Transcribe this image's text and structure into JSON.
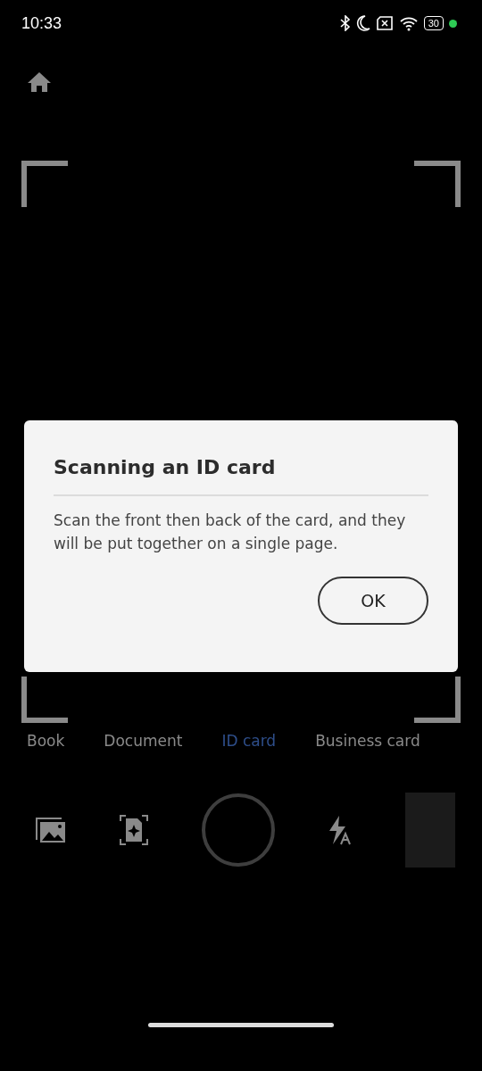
{
  "status_bar": {
    "time": "10:33",
    "battery": "30"
  },
  "dialog": {
    "title": "Scanning an ID card",
    "message": "Scan the front then back of the card, and they will be put together on a single page.",
    "button": "OK"
  },
  "modes": [
    {
      "label": "Book",
      "selected": false
    },
    {
      "label": "Document",
      "selected": false
    },
    {
      "label": "ID card",
      "selected": true
    },
    {
      "label": "Business card",
      "selected": false
    }
  ]
}
